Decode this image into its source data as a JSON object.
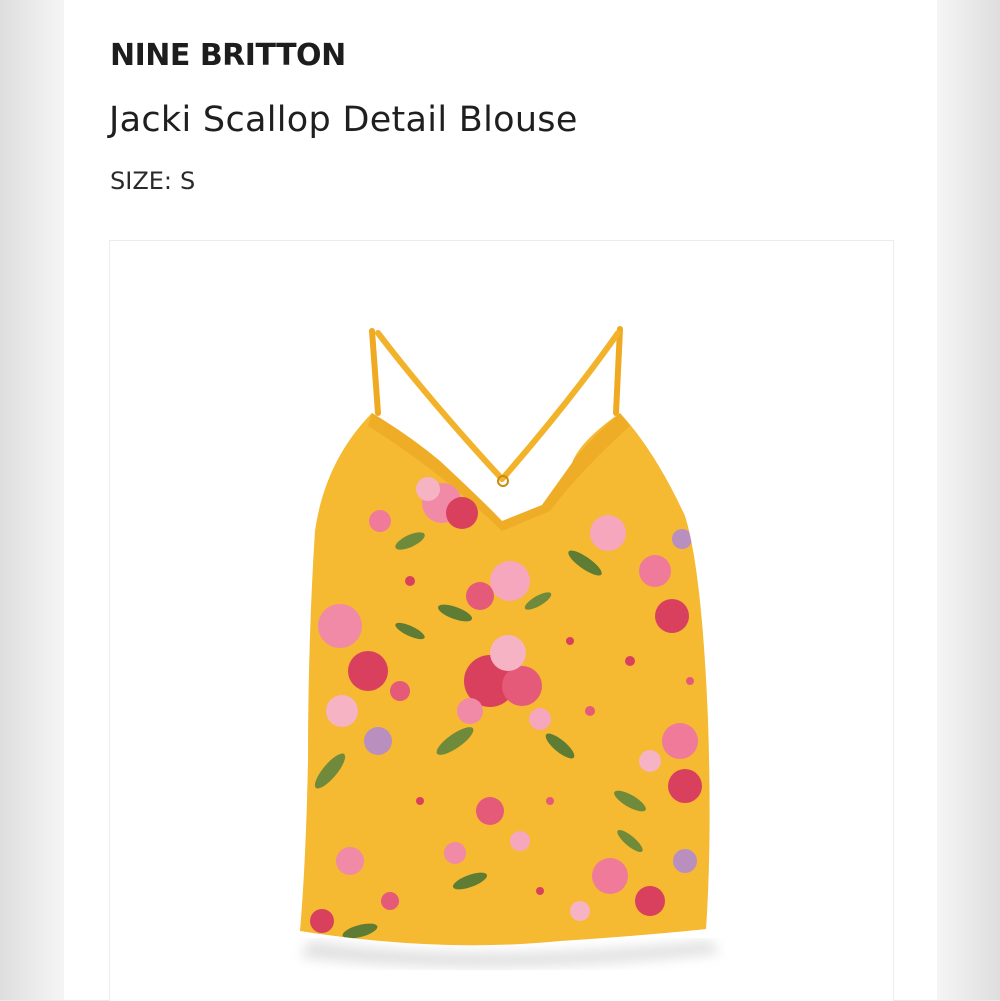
{
  "product": {
    "brand": "NINE BRITTON",
    "name": "Jacki Scallop Detail Blouse",
    "size_label": "SIZE:",
    "size_value": "S"
  },
  "colors": {
    "fabric": "#f4b52a",
    "flower_pink": "#f07a9a",
    "flower_red": "#d9405e",
    "leaf": "#6f8a3a",
    "lavender": "#b98fc0"
  },
  "image": {
    "subject": "garment-photo"
  }
}
